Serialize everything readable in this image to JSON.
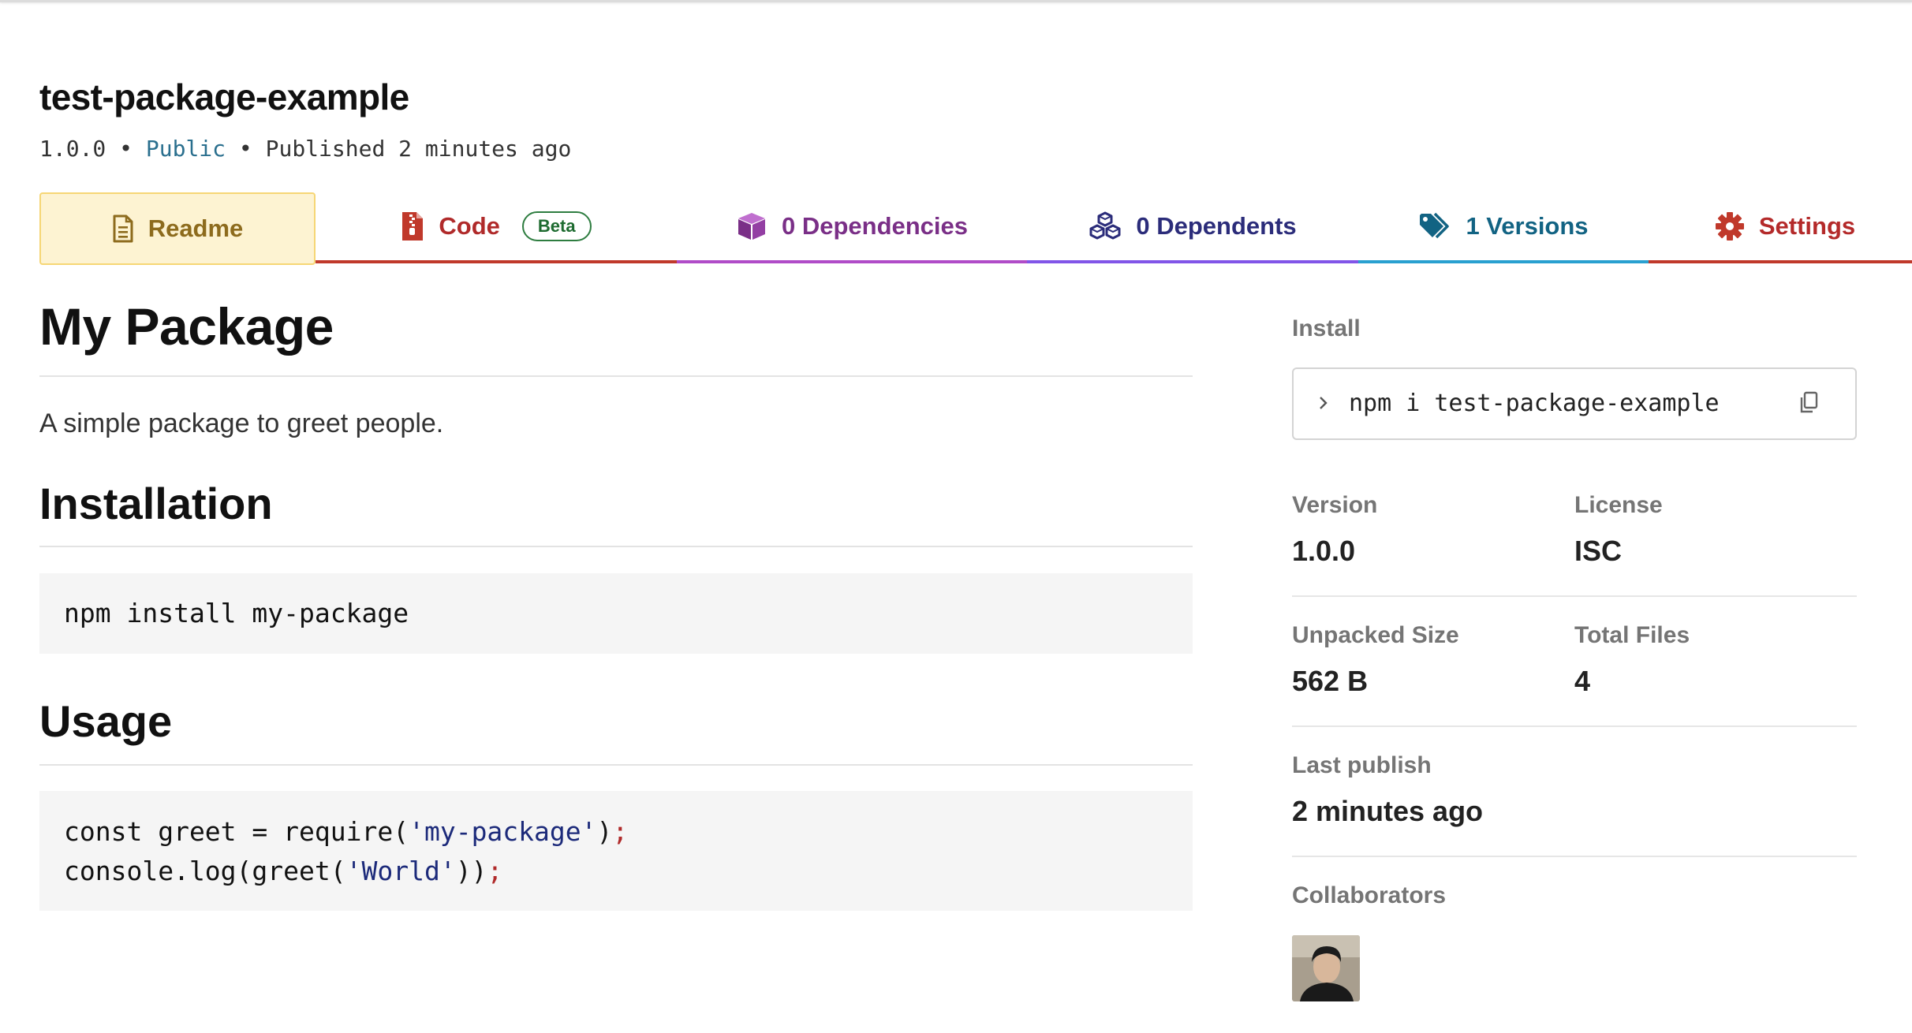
{
  "package": {
    "name": "test-package-example",
    "version": "1.0.0",
    "separator": "•",
    "visibility": "Public",
    "published": "Published 2 minutes ago"
  },
  "tabs": [
    {
      "label": "Readme",
      "icon": "readme-file-icon",
      "color": "#8d6b1d"
    },
    {
      "label": "Code",
      "icon": "code-zip-icon",
      "badge": "Beta",
      "color": "#b02a2a"
    },
    {
      "label": "0 Dependencies",
      "icon": "cube-icon",
      "color": "#7a2f87"
    },
    {
      "label": "0 Dependents",
      "icon": "cubes-icon",
      "color": "#2b2c7a"
    },
    {
      "label": "1 Versions",
      "icon": "tags-icon",
      "color": "#126383"
    },
    {
      "label": "Settings",
      "icon": "gear-icon",
      "color": "#b42a2a"
    }
  ],
  "readme": {
    "title": "My Package",
    "description": "A simple package to greet people.",
    "installation_heading": "Installation",
    "install_code": "npm install my-package",
    "usage_heading": "Usage",
    "usage_code": {
      "line1_a": "const greet = require(",
      "line1_str": "'my-package'",
      "line1_b": ")",
      "line1_semi": ";",
      "line2_a": "console.log(greet(",
      "line2_str": "'World'",
      "line2_b": "))",
      "line2_semi": ";"
    }
  },
  "sidebar": {
    "install_label": "Install",
    "install_command": "npm i test-package-example",
    "version_label": "Version",
    "version_value": "1.0.0",
    "license_label": "License",
    "license_value": "ISC",
    "unpacked_label": "Unpacked Size",
    "unpacked_value": "562 B",
    "files_label": "Total Files",
    "files_value": "4",
    "last_publish_label": "Last publish",
    "last_publish_value": "2 minutes ago",
    "collaborators_label": "Collaborators"
  }
}
